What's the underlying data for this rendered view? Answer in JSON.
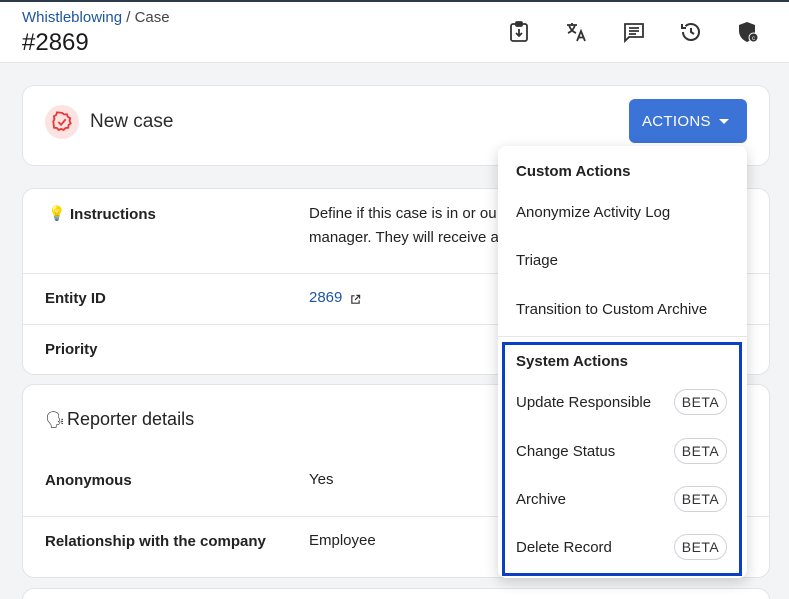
{
  "header": {
    "breadcrumb_link": "Whistleblowing",
    "breadcrumb_sep": " / ",
    "breadcrumb_current": "Case",
    "case_number": "#2869",
    "icons": [
      "download-clipboard-icon",
      "translate-icon",
      "comment-icon",
      "history-icon",
      "security-shield-icon"
    ]
  },
  "status_card": {
    "title": "New case",
    "icon": "status-badge-icon",
    "accent": "#e53935",
    "actions_label": "ACTIONS",
    "actions_color": "#3b73d6"
  },
  "details": {
    "instructions_label": "Instructions",
    "instructions_icon": "lightbulb-icon",
    "instructions_text_line1": "Define if this case is in or ou",
    "instructions_text_line2": "manager. They will receive a",
    "entity_id_label": "Entity ID",
    "entity_id_value": "2869",
    "priority_label": "Priority"
  },
  "reporter": {
    "title": "Reporter details",
    "icon": "speaking-head-icon",
    "anonymous_label": "Anonymous",
    "anonymous_value": "Yes",
    "relationship_label": "Relationship with the company",
    "relationship_value": "Employee"
  },
  "menu": {
    "custom_heading": "Custom Actions",
    "custom_items": [
      "Anonymize Activity Log",
      "Triage",
      "Transition to Custom Archive"
    ],
    "system_heading": "System Actions",
    "system_items": [
      "Update Responsible",
      "Change Status",
      "Archive",
      "Delete Record"
    ],
    "badge": "BETA",
    "highlight_color": "#0d3fc4"
  }
}
